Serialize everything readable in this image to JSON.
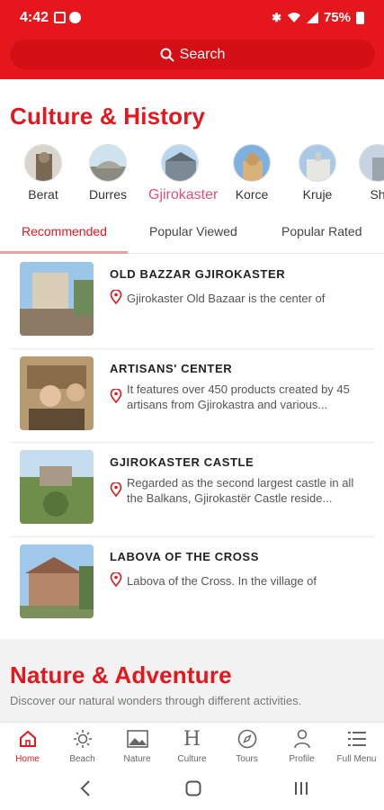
{
  "status_bar": {
    "time": "4:42",
    "battery": "75%"
  },
  "header": {
    "search_label": "Search"
  },
  "culture": {
    "title": "Culture & History",
    "categories": [
      {
        "label": "Berat"
      },
      {
        "label": "Durres"
      },
      {
        "label": "Gjirokaster",
        "active": true
      },
      {
        "label": "Korce"
      },
      {
        "label": "Kruje"
      },
      {
        "label": "Sh"
      }
    ],
    "tabs": [
      {
        "label": "Recommended",
        "active": true
      },
      {
        "label": "Popular Viewed"
      },
      {
        "label": "Popular Rated"
      }
    ],
    "items": [
      {
        "title": "OLD BAZZAR GJIROKASTER",
        "desc": "Gjirokaster Old Bazaar is the center of"
      },
      {
        "title": "ARTISANS' CENTER",
        "desc": "It features over 450 products created by 45 artisans from Gjirokastra and various..."
      },
      {
        "title": "GJIROKASTER CASTLE",
        "desc": "Regarded as the second largest castle in all the Balkans, Gjirokastër Castle reside..."
      },
      {
        "title": "LABOVA OF THE CROSS",
        "desc": "Labova of the Cross. In the village of"
      }
    ]
  },
  "nature": {
    "title": "Nature & Adventure",
    "subtitle": "Discover our natural wonders through different activities."
  },
  "bottom_nav": [
    {
      "label": "Home",
      "icon": "home-icon",
      "active": true
    },
    {
      "label": "Beach",
      "icon": "sun-icon"
    },
    {
      "label": "Nature",
      "icon": "image-icon"
    },
    {
      "label": "Culture",
      "icon": "h-letter-icon"
    },
    {
      "label": "Tours",
      "icon": "compass-icon"
    },
    {
      "label": "Profile",
      "icon": "person-icon"
    },
    {
      "label": "Full Menu",
      "icon": "menu-list-icon"
    }
  ],
  "colors": {
    "brand_red": "#e5171d",
    "active_pink": "#e0507a"
  }
}
